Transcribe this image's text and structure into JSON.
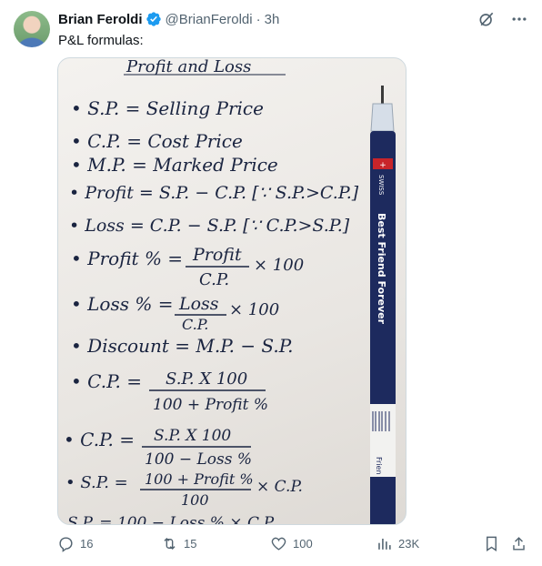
{
  "author": {
    "name": "Brian Feroldi",
    "handle": "@BrianFeroldi",
    "separator": "·",
    "time": "3h"
  },
  "tweet": {
    "text": "P&L formulas:"
  },
  "image": {
    "lines": [
      "Profit and Loss",
      "• S.P. = Selling Price",
      "• C.P. = Cost Price",
      "• M.P. = Marked Price",
      "• Profit = S.P. − C.P. [∵ S.P.>C.P.]",
      "• Loss = C.P. − S.P. [∵ C.P.>S.P.]",
      "• Profit % =",
      "Profit",
      "C.P.",
      "× 100",
      "• Loss % =",
      "Loss",
      "C.P.",
      "× 100",
      "• Discount = M.P. − S.P.",
      "• C.P. =",
      "S.P. X 100",
      "100 + Profit %",
      "• C.P. =",
      "S.P. X 100",
      "100 − Loss %",
      "• S.P. =",
      "100 + Profit %",
      "100",
      "× C.P.",
      "S.P. = 100 − Loss % × C.P."
    ],
    "pen_text": [
      "SWISS",
      "Best Friend Forever",
      "Frien"
    ]
  },
  "actions": {
    "replies": "16",
    "reposts": "15",
    "likes": "100",
    "views": "23K"
  },
  "colors": {
    "verified": "#1d9bf0",
    "muted": "#536471",
    "ink": "#1a2440",
    "pen_body": "#1d2a5e"
  }
}
